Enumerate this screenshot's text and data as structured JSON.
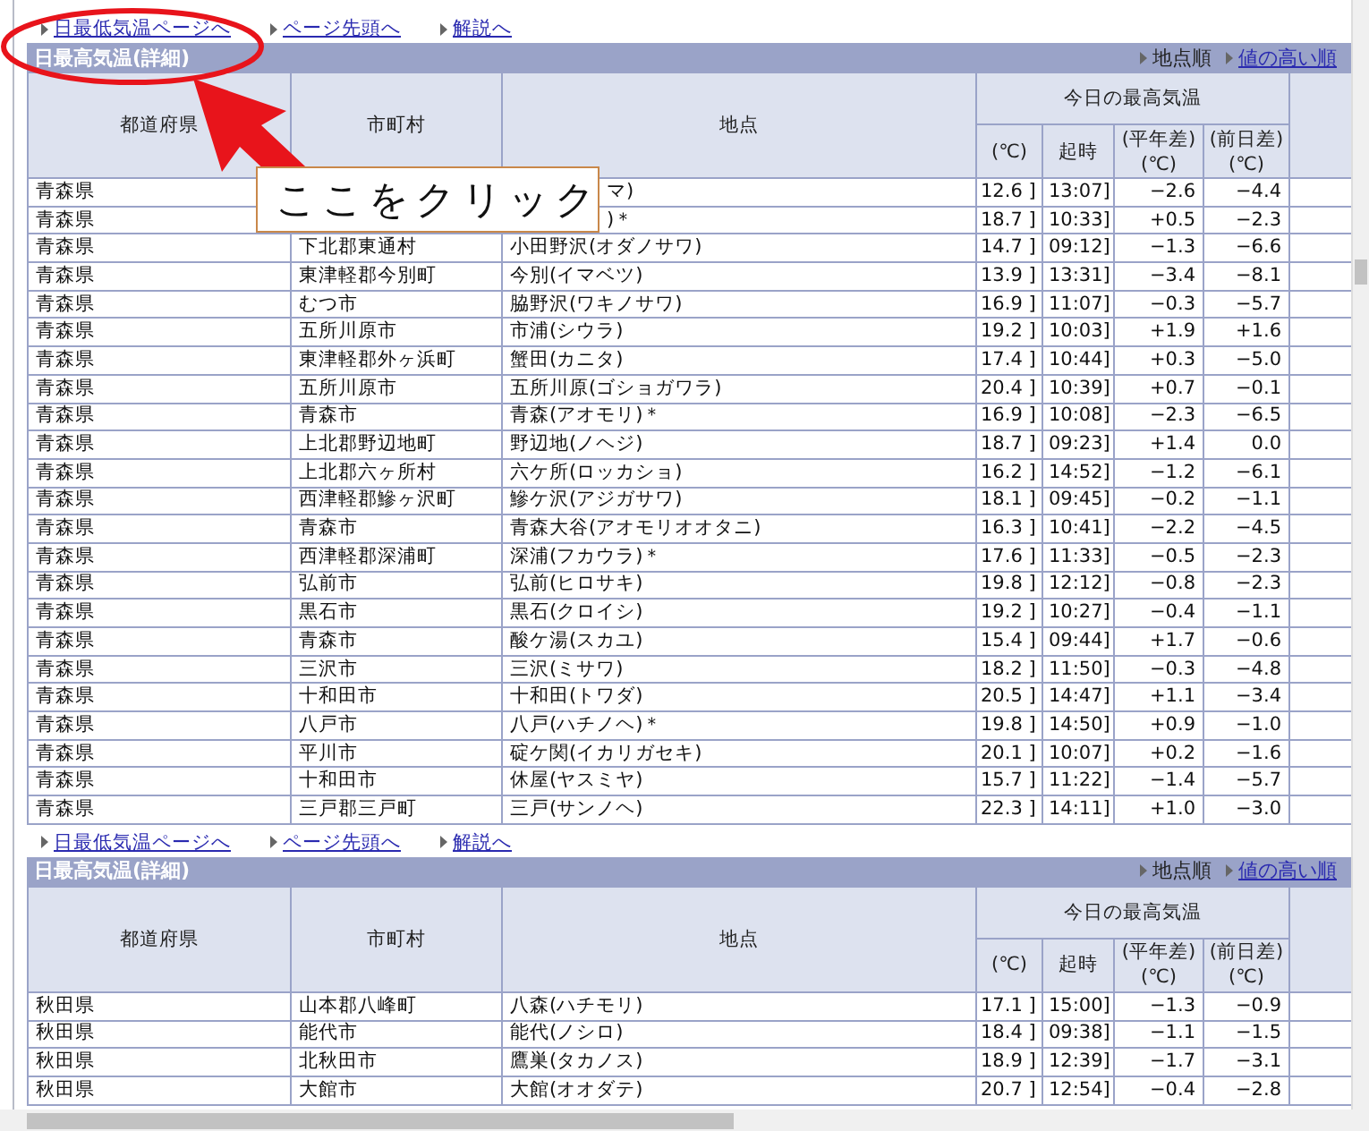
{
  "sections": [
    {
      "links": [
        "日最低気温ページへ",
        "ページ先頭へ",
        "解説へ"
      ],
      "title": "日最高気温(詳細)",
      "sort_links": [
        {
          "label": "地点順",
          "selected": true
        },
        {
          "label": "値の高い順",
          "selected": false
        }
      ],
      "columns": {
        "pref": "都道府県",
        "city": "市町村",
        "point": "地点",
        "group": "今日の最高気温",
        "temp": "(℃)",
        "time": "起時",
        "normal_diff": "(平年差)\n(℃)",
        "prev_diff": "(前日差)\n(℃)"
      },
      "rows": [
        {
          "pref": "青森県",
          "point": "マ)",
          "temp": "12.6 ]",
          "time": "13:07]",
          "normal_diff": "−2.6",
          "prev_diff": "−4.4",
          "covered": true
        },
        {
          "pref": "青森県",
          "point": ")＊",
          "temp": "18.7 ]",
          "time": "10:33]",
          "normal_diff": "+0.5",
          "prev_diff": "−2.3",
          "covered": true
        },
        {
          "pref": "青森県",
          "city": "下北郡東通村",
          "point": "小田野沢(オダノサワ)",
          "temp": "14.7 ]",
          "time": "09:12]",
          "normal_diff": "−1.3",
          "prev_diff": "−6.6"
        },
        {
          "pref": "青森県",
          "city": "東津軽郡今別町",
          "point": "今別(イマベツ)",
          "temp": "13.9 ]",
          "time": "13:31]",
          "normal_diff": "−3.4",
          "prev_diff": "−8.1"
        },
        {
          "pref": "青森県",
          "city": "むつ市",
          "point": "脇野沢(ワキノサワ)",
          "temp": "16.9 ]",
          "time": "11:07]",
          "normal_diff": "−0.3",
          "prev_diff": "−5.7"
        },
        {
          "pref": "青森県",
          "city": "五所川原市",
          "point": "市浦(シウラ)",
          "temp": "19.2 ]",
          "time": "10:03]",
          "normal_diff": "+1.9",
          "prev_diff": "+1.6"
        },
        {
          "pref": "青森県",
          "city": "東津軽郡外ヶ浜町",
          "point": "蟹田(カニタ)",
          "temp": "17.4 ]",
          "time": "10:44]",
          "normal_diff": "+0.3",
          "prev_diff": "−5.0"
        },
        {
          "pref": "青森県",
          "city": "五所川原市",
          "point": "五所川原(ゴショガワラ)",
          "temp": "20.4 ]",
          "time": "10:39]",
          "normal_diff": "+0.7",
          "prev_diff": "−0.1"
        },
        {
          "pref": "青森県",
          "city": "青森市",
          "point": "青森(アオモリ)＊",
          "temp": "16.9 ]",
          "time": "10:08]",
          "normal_diff": "−2.3",
          "prev_diff": "−6.5"
        },
        {
          "pref": "青森県",
          "city": "上北郡野辺地町",
          "point": "野辺地(ノヘジ)",
          "temp": "18.7 ]",
          "time": "09:23]",
          "normal_diff": "+1.4",
          "prev_diff": "0.0"
        },
        {
          "pref": "青森県",
          "city": "上北郡六ヶ所村",
          "point": "六ケ所(ロッカショ)",
          "temp": "16.2 ]",
          "time": "14:52]",
          "normal_diff": "−1.2",
          "prev_diff": "−6.1"
        },
        {
          "pref": "青森県",
          "city": "西津軽郡鰺ヶ沢町",
          "point": "鰺ケ沢(アジガサワ)",
          "temp": "18.1 ]",
          "time": "09:45]",
          "normal_diff": "−0.2",
          "prev_diff": "−1.1"
        },
        {
          "pref": "青森県",
          "city": "青森市",
          "point": "青森大谷(アオモリオオタニ)",
          "temp": "16.3 ]",
          "time": "10:41]",
          "normal_diff": "−2.2",
          "prev_diff": "−4.5"
        },
        {
          "pref": "青森県",
          "city": "西津軽郡深浦町",
          "point": "深浦(フカウラ)＊",
          "temp": "17.6 ]",
          "time": "11:33]",
          "normal_diff": "−0.5",
          "prev_diff": "−2.3"
        },
        {
          "pref": "青森県",
          "city": "弘前市",
          "point": "弘前(ヒロサキ)",
          "temp": "19.8 ]",
          "time": "12:12]",
          "normal_diff": "−0.8",
          "prev_diff": "−2.3"
        },
        {
          "pref": "青森県",
          "city": "黒石市",
          "point": "黒石(クロイシ)",
          "temp": "19.2 ]",
          "time": "10:27]",
          "normal_diff": "−0.4",
          "prev_diff": "−1.1"
        },
        {
          "pref": "青森県",
          "city": "青森市",
          "point": "酸ケ湯(スカユ)",
          "temp": "15.4 ]",
          "time": "09:44]",
          "normal_diff": "+1.7",
          "prev_diff": "−0.6"
        },
        {
          "pref": "青森県",
          "city": "三沢市",
          "point": "三沢(ミサワ)",
          "temp": "18.2 ]",
          "time": "11:50]",
          "normal_diff": "−0.3",
          "prev_diff": "−4.8"
        },
        {
          "pref": "青森県",
          "city": "十和田市",
          "point": "十和田(トワダ)",
          "temp": "20.5 ]",
          "time": "14:47]",
          "normal_diff": "+1.1",
          "prev_diff": "−3.4"
        },
        {
          "pref": "青森県",
          "city": "八戸市",
          "point": "八戸(ハチノヘ)＊",
          "temp": "19.8 ]",
          "time": "14:50]",
          "normal_diff": "+0.9",
          "prev_diff": "−1.0"
        },
        {
          "pref": "青森県",
          "city": "平川市",
          "point": "碇ケ関(イカリガセキ)",
          "temp": "20.1 ]",
          "time": "10:07]",
          "normal_diff": "+0.2",
          "prev_diff": "−1.6"
        },
        {
          "pref": "青森県",
          "city": "十和田市",
          "point": "休屋(ヤスミヤ)",
          "temp": "15.7 ]",
          "time": "11:22]",
          "normal_diff": "−1.4",
          "prev_diff": "−5.7"
        },
        {
          "pref": "青森県",
          "city": "三戸郡三戸町",
          "point": "三戸(サンノヘ)",
          "temp": "22.3 ]",
          "time": "14:11]",
          "normal_diff": "+1.0",
          "prev_diff": "−3.0"
        }
      ]
    },
    {
      "links": [
        "日最低気温ページへ",
        "ページ先頭へ",
        "解説へ"
      ],
      "title": "日最高気温(詳細)",
      "sort_links": [
        {
          "label": "地点順",
          "selected": true
        },
        {
          "label": "値の高い順",
          "selected": false
        }
      ],
      "columns": {
        "pref": "都道府県",
        "city": "市町村",
        "point": "地点",
        "group": "今日の最高気温",
        "temp": "(℃)",
        "time": "起時",
        "normal_diff": "(平年差)\n(℃)",
        "prev_diff": "(前日差)\n(℃)"
      },
      "rows": [
        {
          "pref": "秋田県",
          "city": "山本郡八峰町",
          "point": "八森(ハチモリ)",
          "temp": "17.1 ]",
          "time": "15:00]",
          "normal_diff": "−1.3",
          "prev_diff": "−0.9"
        },
        {
          "pref": "秋田県",
          "city": "能代市",
          "point": "能代(ノシロ)",
          "temp": "18.4 ]",
          "time": "09:38]",
          "normal_diff": "−1.1",
          "prev_diff": "−1.5"
        },
        {
          "pref": "秋田県",
          "city": "北秋田市",
          "point": "鷹巣(タカノス)",
          "temp": "18.9 ]",
          "time": "12:39]",
          "normal_diff": "−1.7",
          "prev_diff": "−3.1"
        },
        {
          "pref": "秋田県",
          "city": "大館市",
          "point": "大館(オオダテ)",
          "temp": "20.7 ]",
          "time": "12:54]",
          "normal_diff": "−0.4",
          "prev_diff": "−2.8"
        }
      ]
    }
  ],
  "annotation": {
    "text": "ここをクリック"
  }
}
